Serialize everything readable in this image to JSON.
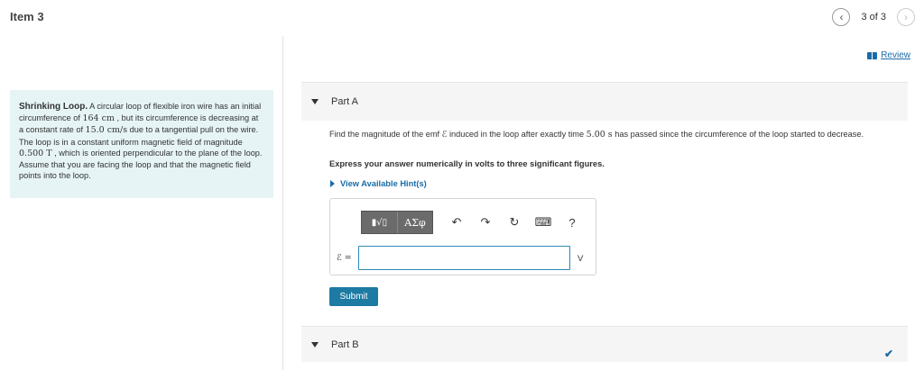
{
  "header": {
    "item_title": "Item 3",
    "nav_prev_icon": "chevron-left",
    "nav_next_icon": "chevron-right",
    "nav_count": "3 of 3",
    "review_label": "Review"
  },
  "problem": {
    "lead": "Shrinking Loop.",
    "text": [
      " A circular loop of flexible iron wire has an initial circumference of ",
      "164 cm",
      " , but its circumference is decreasing at a constant rate of ",
      "15.0 cm/s",
      " due to a tangential pull on the wire. The loop is in a constant uniform magnetic field of magnitude ",
      "0.500 T",
      " , which is oriented perpendicular to the plane of the loop. Assume that you are facing the loop and that the magnetic field points into the loop."
    ]
  },
  "part_a": {
    "label": "Part A",
    "question_parts": [
      "Find the magnitude of the emf ",
      "ℰ",
      " induced in the loop after exactly time ",
      "5.00 s",
      " has passed since the circumference of the loop started to decrease."
    ],
    "instruction": "Express your answer numerically in volts to three significant figures.",
    "hints_label": "View Available Hint(s)",
    "toolbar": {
      "templates_label": "▮√▯",
      "symbols_label": "ΑΣφ",
      "undo_icon": "↶",
      "redo_icon": "↷",
      "reset_icon": "↻",
      "keyboard_icon": "⌨",
      "help_label": "?"
    },
    "answer_label": "ℰ =",
    "answer_value": "",
    "unit": "V",
    "submit_label": "Submit"
  },
  "part_b": {
    "label": "Part B",
    "status_icon": "✔"
  },
  "colors": {
    "accent": "#1a6ca8",
    "problem_bg": "#e6f4f6",
    "submit_bg": "#1d7aa3"
  }
}
